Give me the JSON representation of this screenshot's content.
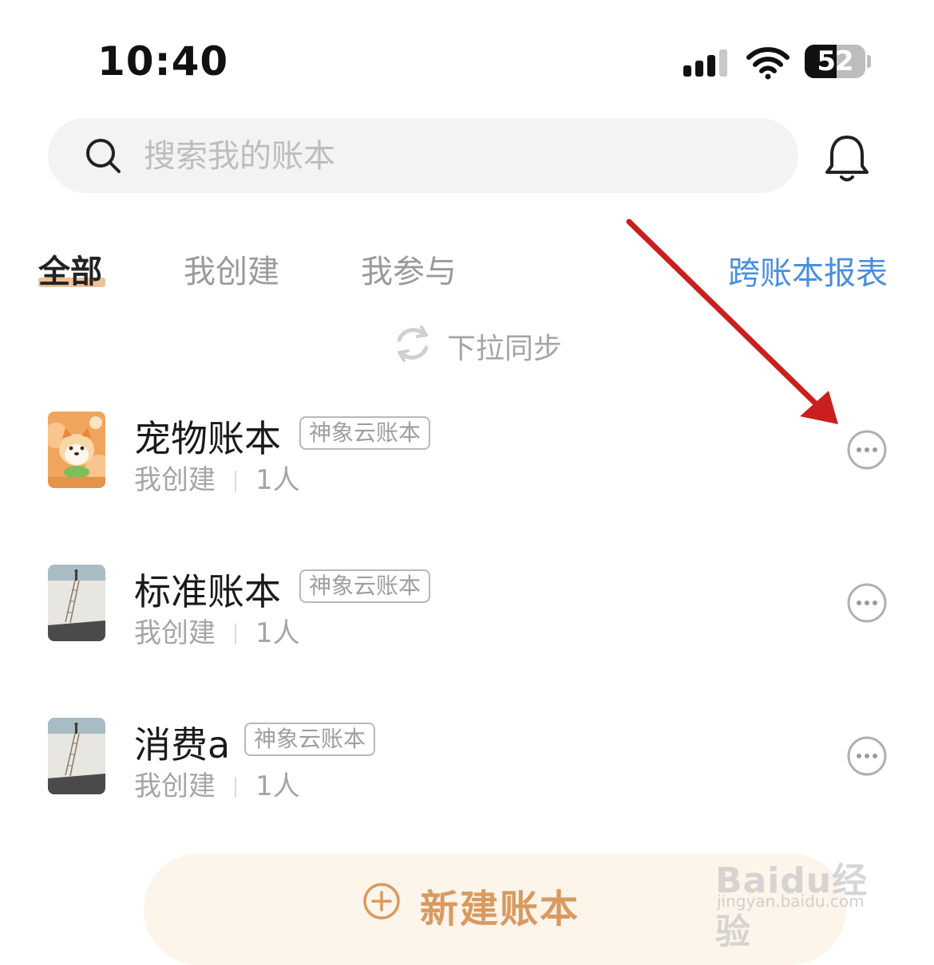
{
  "status_bar": {
    "time": "10:40",
    "battery": "52",
    "battery_level": 0.52,
    "icons": [
      "cellular-signal-icon",
      "wifi-icon",
      "battery-icon"
    ]
  },
  "search": {
    "placeholder": "搜索我的账本",
    "value": ""
  },
  "tabs": [
    {
      "label": "全部",
      "active": true
    },
    {
      "label": "我创建",
      "active": false
    },
    {
      "label": "我参与",
      "active": false
    }
  ],
  "report_link": "跨账本报表",
  "sync_hint": "下拉同步",
  "books": [
    {
      "name": "宠物账本",
      "badge": "神象云账本",
      "role": "我创建",
      "members": "1人",
      "thumb": "shiba-dog-cover"
    },
    {
      "name": "标准账本",
      "badge": "神象云账本",
      "role": "我创建",
      "members": "1人",
      "thumb": "ladder-wall-cover"
    },
    {
      "name": "消费a",
      "badge": "神象云账本",
      "role": "我创建",
      "members": "1人",
      "thumb": "ladder-wall-cover"
    }
  ],
  "new_book_button": "新建账本",
  "watermark": {
    "brand": "Baidu经验",
    "url": "jingyan.baidu.com"
  },
  "colors": {
    "accent": "#e9b78a",
    "link": "#4a8fdc",
    "new_button_text": "#d99a60",
    "annotation_arrow": "#c9201f"
  }
}
